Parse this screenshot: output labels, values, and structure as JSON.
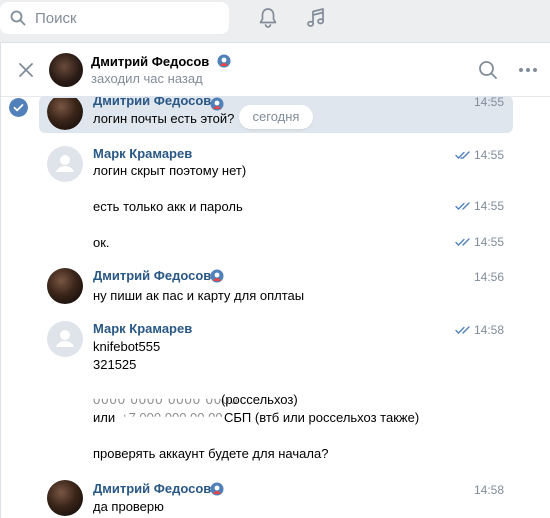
{
  "search": {
    "placeholder": "Поиск"
  },
  "header": {
    "name": "Дмитрий Федосов",
    "status": "заходил час назад"
  },
  "date_pill": "сегодня",
  "messages": [
    {
      "author": "Дмитрий Федосов",
      "time": "14:55",
      "text": "логин почты есть этой?"
    },
    {
      "author": "Марк Крамарев",
      "time": "14:55",
      "text": "логин скрыт поэтому нет)"
    },
    {
      "time": "14:55",
      "text": "есть только акк и пароль"
    },
    {
      "time": "14:55",
      "text": "ок."
    },
    {
      "author": "Дмитрий Федосов",
      "time": "14:56",
      "text": "ну пиши ак пас и карту для оплтаы"
    },
    {
      "author": "Марк Крамарев",
      "time": "14:58",
      "lines": [
        "knifebot555",
        "321525",
        "(россельхоз)",
        "или",
        "СБП (втб или россельхоз также)",
        "проверять аккаунт будете для начала?"
      ]
    },
    {
      "author": "Дмитрий Федосов",
      "time": "14:58",
      "text": "да проверю"
    }
  ],
  "colors": {
    "accent": "#5181b8",
    "author": "#2a5885",
    "muted": "#818c99",
    "selected": "#dfe6ee"
  }
}
